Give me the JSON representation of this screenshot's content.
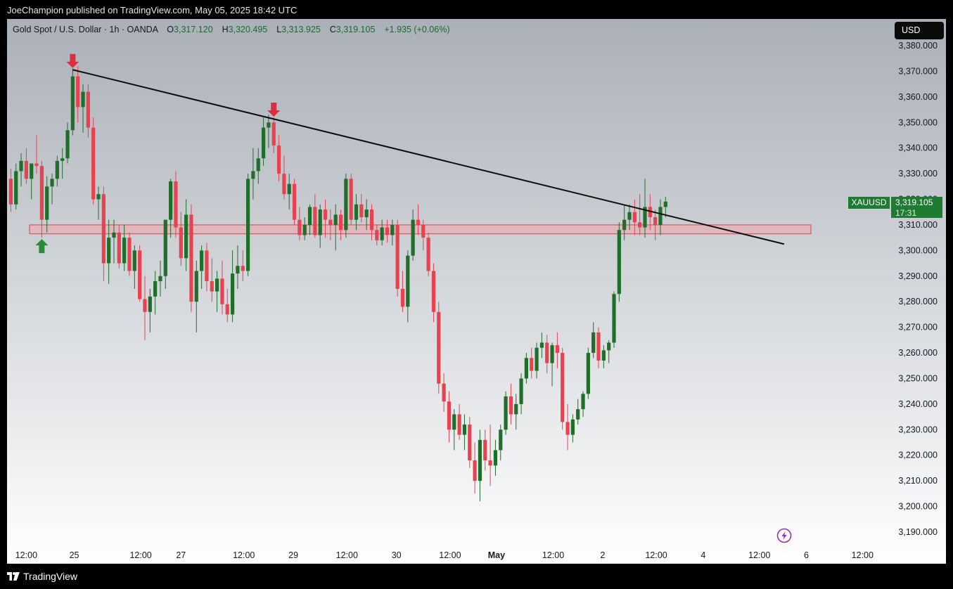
{
  "header": {
    "publish_line": "JoeChampion published on TradingView.com, May 05, 2025 18:42 UTC"
  },
  "legend": {
    "symbol": "Gold Spot / U.S. Dollar · 1h · OANDA",
    "open_label": "O",
    "open": "3,317.120",
    "high_label": "H",
    "high": "3,320.495",
    "low_label": "L",
    "low": "3,313.925",
    "close_label": "C",
    "close": "3,319.105",
    "change": "+1.935 (+0.06%)"
  },
  "currency_button": "USD",
  "last_price": {
    "symbol": "XAUUSD",
    "price": "3,319.105",
    "countdown": "17:31"
  },
  "footer": {
    "brand": "TradingView"
  },
  "colors": {
    "up": "#1f6e2a",
    "down": "#e8414f",
    "zone_fill": "#f0a6ad",
    "zone_stroke": "#d9434f",
    "trendline": "#0d0d0d"
  },
  "chart_data": {
    "type": "candlestick",
    "symbol": "XAUUSD",
    "timeframe": "1h",
    "ylim": [
      3190,
      3380
    ],
    "y_ticks": [
      "3,190.000",
      "3,200.000",
      "3,210.000",
      "3,220.000",
      "3,230.000",
      "3,240.000",
      "3,250.000",
      "3,260.000",
      "3,270.000",
      "3,280.000",
      "3,290.000",
      "3,300.000",
      "3,310.000",
      "3,320.000",
      "3,330.000",
      "3,340.000",
      "3,350.000",
      "3,360.000",
      "3,370.000",
      "3,380.000"
    ],
    "x_ticks": [
      "12:00",
      "25",
      "12:00",
      "27",
      "12:00",
      "29",
      "12:00",
      "30",
      "12:00",
      "May",
      "12:00",
      "2",
      "12:00",
      "4",
      "12:00",
      "6",
      "12:00"
    ],
    "candles": [
      [
        3328,
        3332,
        3315,
        3318
      ],
      [
        3318,
        3334,
        3316,
        3331
      ],
      [
        3331,
        3338,
        3325,
        3335
      ],
      [
        3335,
        3340,
        3326,
        3328
      ],
      [
        3328,
        3334,
        3320,
        3334
      ],
      [
        3334,
        3345,
        3330,
        3333
      ],
      [
        3333,
        3335,
        3305,
        3312
      ],
      [
        3312,
        3329,
        3307,
        3325
      ],
      [
        3325,
        3330,
        3318,
        3328
      ],
      [
        3328,
        3337,
        3325,
        3335
      ],
      [
        3335,
        3340,
        3328,
        3336
      ],
      [
        3336,
        3350,
        3334,
        3347
      ],
      [
        3347,
        3371,
        3345,
        3368
      ],
      [
        3368,
        3372,
        3350,
        3356
      ],
      [
        3356,
        3365,
        3346,
        3362
      ],
      [
        3362,
        3365,
        3344,
        3348
      ],
      [
        3348,
        3352,
        3318,
        3320
      ],
      [
        3320,
        3325,
        3312,
        3322
      ],
      [
        3322,
        3325,
        3288,
        3295
      ],
      [
        3295,
        3312,
        3287,
        3305
      ],
      [
        3305,
        3312,
        3295,
        3307
      ],
      [
        3307,
        3310,
        3293,
        3295
      ],
      [
        3295,
        3310,
        3292,
        3305
      ],
      [
        3305,
        3307,
        3290,
        3292
      ],
      [
        3292,
        3302,
        3285,
        3300
      ],
      [
        3300,
        3302,
        3280,
        3281
      ],
      [
        3281,
        3290,
        3265,
        3276
      ],
      [
        3276,
        3285,
        3268,
        3282
      ],
      [
        3282,
        3292,
        3275,
        3288
      ],
      [
        3288,
        3296,
        3282,
        3290
      ],
      [
        3290,
        3303,
        3285,
        3312
      ],
      [
        3312,
        3328,
        3305,
        3327
      ],
      [
        3327,
        3331,
        3305,
        3309
      ],
      [
        3309,
        3315,
        3294,
        3297
      ],
      [
        3297,
        3320,
        3292,
        3314
      ],
      [
        3314,
        3318,
        3276,
        3280
      ],
      [
        3280,
        3296,
        3268,
        3292
      ],
      [
        3292,
        3302,
        3285,
        3300
      ],
      [
        3300,
        3303,
        3284,
        3288
      ],
      [
        3288,
        3297,
        3280,
        3284
      ],
      [
        3284,
        3292,
        3276,
        3289
      ],
      [
        3289,
        3296,
        3275,
        3279
      ],
      [
        3279,
        3285,
        3272,
        3275
      ],
      [
        3275,
        3300,
        3272,
        3291
      ],
      [
        3291,
        3302,
        3285,
        3294
      ],
      [
        3294,
        3300,
        3288,
        3292
      ],
      [
        3292,
        3330,
        3290,
        3328
      ],
      [
        3328,
        3340,
        3320,
        3331
      ],
      [
        3331,
        3340,
        3326,
        3336
      ],
      [
        3336,
        3352,
        3333,
        3348
      ],
      [
        3348,
        3353,
        3340,
        3350
      ],
      [
        3350,
        3352,
        3338,
        3341
      ],
      [
        3341,
        3345,
        3327,
        3330
      ],
      [
        3330,
        3337,
        3320,
        3322
      ],
      [
        3322,
        3330,
        3316,
        3326
      ],
      [
        3326,
        3328,
        3310,
        3312
      ],
      [
        3312,
        3317,
        3304,
        3306
      ],
      [
        3306,
        3313,
        3304,
        3310
      ],
      [
        3310,
        3318,
        3306,
        3317
      ],
      [
        3317,
        3322,
        3305,
        3306
      ],
      [
        3306,
        3318,
        3301,
        3316
      ],
      [
        3316,
        3320,
        3305,
        3312
      ],
      [
        3312,
        3316,
        3304,
        3310
      ],
      [
        3310,
        3318,
        3300,
        3314
      ],
      [
        3314,
        3316,
        3304,
        3308
      ],
      [
        3308,
        3330,
        3305,
        3328
      ],
      [
        3328,
        3330,
        3310,
        3312
      ],
      [
        3312,
        3322,
        3308,
        3318
      ],
      [
        3318,
        3322,
        3311,
        3313
      ],
      [
        3313,
        3320,
        3308,
        3316
      ],
      [
        3316,
        3318,
        3304,
        3308
      ],
      [
        3308,
        3310,
        3302,
        3304
      ],
      [
        3304,
        3312,
        3302,
        3309
      ],
      [
        3309,
        3312,
        3303,
        3306
      ],
      [
        3306,
        3312,
        3302,
        3310
      ],
      [
        3310,
        3312,
        3282,
        3285
      ],
      [
        3285,
        3292,
        3276,
        3278
      ],
      [
        3278,
        3300,
        3272,
        3298
      ],
      [
        3298,
        3316,
        3296,
        3312
      ],
      [
        3312,
        3318,
        3306,
        3310
      ],
      [
        3310,
        3312,
        3300,
        3305
      ],
      [
        3305,
        3307,
        3290,
        3292
      ],
      [
        3292,
        3295,
        3272,
        3276
      ],
      [
        3276,
        3280,
        3244,
        3248
      ],
      [
        3248,
        3252,
        3237,
        3241
      ],
      [
        3241,
        3245,
        3225,
        3230
      ],
      [
        3230,
        3238,
        3222,
        3236
      ],
      [
        3236,
        3240,
        3226,
        3228
      ],
      [
        3228,
        3236,
        3222,
        3232
      ],
      [
        3232,
        3235,
        3215,
        3218
      ],
      [
        3218,
        3225,
        3205,
        3210
      ],
      [
        3210,
        3230,
        3202,
        3226
      ],
      [
        3226,
        3230,
        3214,
        3218
      ],
      [
        3218,
        3232,
        3208,
        3216
      ],
      [
        3216,
        3226,
        3212,
        3222
      ],
      [
        3222,
        3232,
        3218,
        3230
      ],
      [
        3230,
        3245,
        3228,
        3243
      ],
      [
        3243,
        3248,
        3232,
        3236
      ],
      [
        3236,
        3244,
        3230,
        3240
      ],
      [
        3240,
        3252,
        3236,
        3250
      ],
      [
        3250,
        3260,
        3248,
        3258
      ],
      [
        3258,
        3262,
        3250,
        3253
      ],
      [
        3253,
        3264,
        3250,
        3262
      ],
      [
        3262,
        3268,
        3258,
        3264
      ],
      [
        3264,
        3267,
        3252,
        3256
      ],
      [
        3256,
        3264,
        3247,
        3263
      ],
      [
        3263,
        3268,
        3254,
        3260
      ],
      [
        3260,
        3262,
        3230,
        3233
      ],
      [
        3233,
        3240,
        3222,
        3228
      ],
      [
        3228,
        3236,
        3225,
        3234
      ],
      [
        3234,
        3242,
        3232,
        3238
      ],
      [
        3238,
        3245,
        3235,
        3244
      ],
      [
        3244,
        3262,
        3242,
        3260
      ],
      [
        3260,
        3272,
        3258,
        3268
      ],
      [
        3268,
        3270,
        3254,
        3257
      ],
      [
        3257,
        3263,
        3254,
        3261
      ],
      [
        3261,
        3265,
        3256,
        3264
      ],
      [
        3264,
        3284,
        3262,
        3283
      ],
      [
        3283,
        3311,
        3280,
        3308
      ],
      [
        3308,
        3318,
        3304,
        3312
      ],
      [
        3312,
        3318,
        3308,
        3315
      ],
      [
        3315,
        3320,
        3306,
        3311
      ],
      [
        3311,
        3322,
        3306,
        3309
      ],
      [
        3309,
        3328,
        3305,
        3317
      ],
      [
        3317,
        3322,
        3308,
        3313
      ],
      [
        3313,
        3316,
        3304,
        3310
      ],
      [
        3310,
        3320,
        3306,
        3317
      ],
      [
        3317,
        3321,
        3313,
        3319.1
      ]
    ],
    "resistance_zone": [
      3306.5,
      3310
    ],
    "trendline": [
      {
        "candle": 12,
        "price": 3370.6
      },
      {
        "candle": 150,
        "price": 3302.5
      }
    ],
    "markers": [
      {
        "type": "arrow-down",
        "candle": 12,
        "color": "#d9303f"
      },
      {
        "type": "arrow-down",
        "candle": 51,
        "color": "#d9303f"
      },
      {
        "type": "arrow-up",
        "candle": 6,
        "color": "#2b8a3e"
      }
    ],
    "last_price": 3319.105
  }
}
